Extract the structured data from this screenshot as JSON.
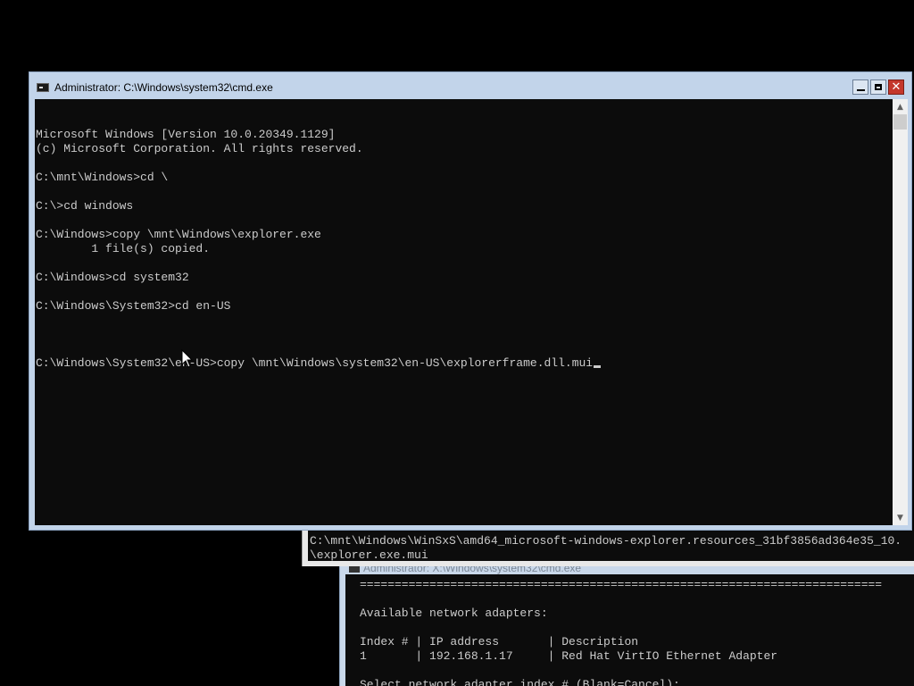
{
  "back_window_2": {
    "title": "Administrator: X:\\Windows\\system32\\cmd.exe",
    "lines": [
      "===========================================================================",
      "",
      "Available network adapters:",
      "",
      "Index # | IP address       | Description",
      "1       | 192.168.1.17     | Red Hat VirtIO Ethernet Adapter",
      "",
      "Select network adapter index # (Blank=Cancel):"
    ]
  },
  "back_window_1": {
    "lines": [
      "C:\\mnt\\Windows\\WinSxS\\amd64_microsoft-windows-explorer.resources_31bf3856ad364e35_10.",
      "\\explorer.exe.mui"
    ]
  },
  "main_window": {
    "title": "Administrator: C:\\Windows\\system32\\cmd.exe",
    "icon": "console-icon",
    "buttons": {
      "minimize": "minimize-icon",
      "maximize": "maximize-icon",
      "close_glyph": "✕"
    },
    "console_lines": [
      "Microsoft Windows [Version 10.0.20349.1129]",
      "(c) Microsoft Corporation. All rights reserved.",
      "",
      "C:\\mnt\\Windows>cd \\",
      "",
      "C:\\>cd windows",
      "",
      "C:\\Windows>copy \\mnt\\Windows\\explorer.exe",
      "        1 file(s) copied.",
      "",
      "C:\\Windows>cd system32",
      "",
      "C:\\Windows\\System32>cd en-US",
      ""
    ],
    "prompt_line": "C:\\Windows\\System32\\en-US>copy \\mnt\\Windows\\system32\\en-US\\explorerframe.dll.mui",
    "scrollbar": {
      "up_arrow": "▲",
      "down_arrow": "▼"
    }
  },
  "colors": {
    "console_bg": "#0c0c0c",
    "console_text": "#cccccc",
    "titlebar": "#c2d4ea",
    "close_button": "#c4372c"
  }
}
